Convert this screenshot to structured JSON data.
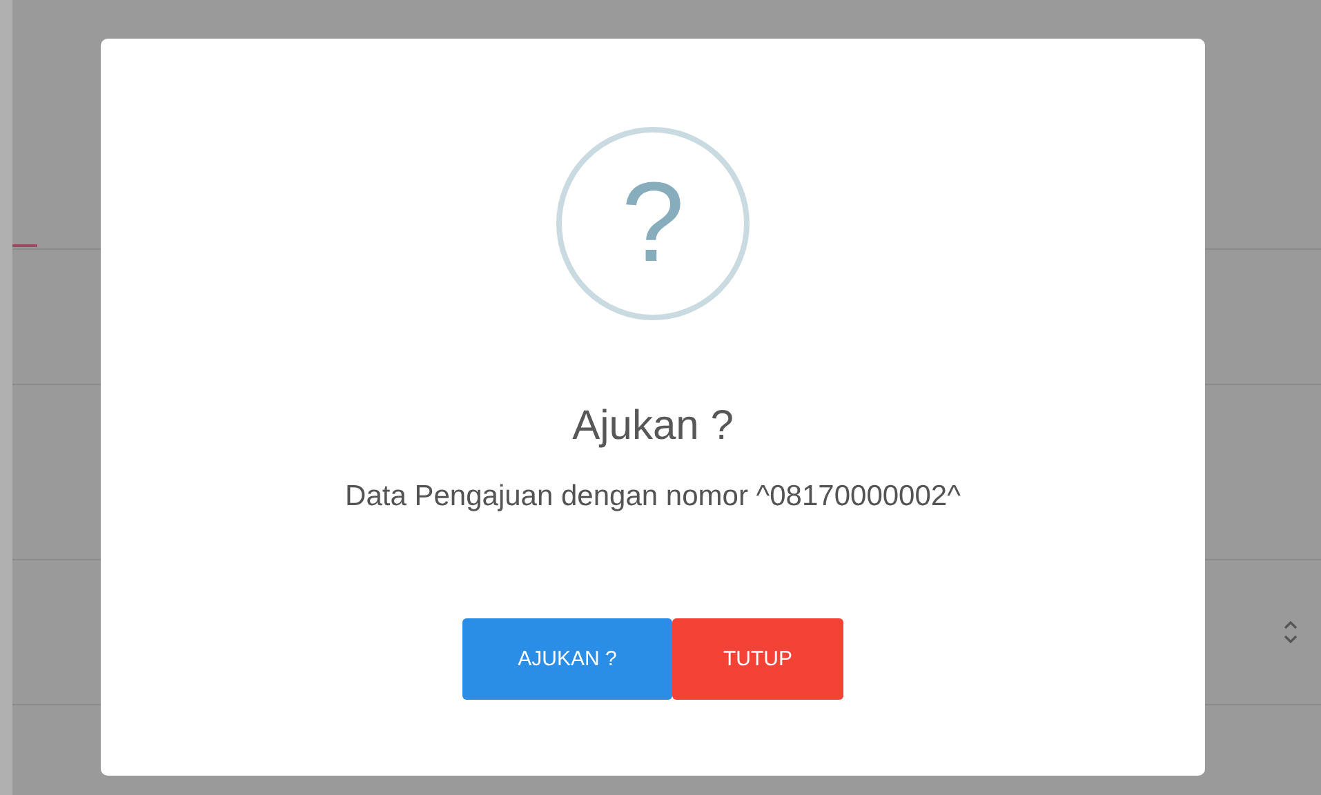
{
  "dialog": {
    "icon": "?",
    "title": "Ajukan ?",
    "message": "Data Pengajuan dengan nomor ^08170000002^",
    "buttons": [
      {
        "label": "AJUKAN ?",
        "kind": "confirm"
      },
      {
        "label": "TUTUP",
        "kind": "cancel"
      }
    ]
  }
}
